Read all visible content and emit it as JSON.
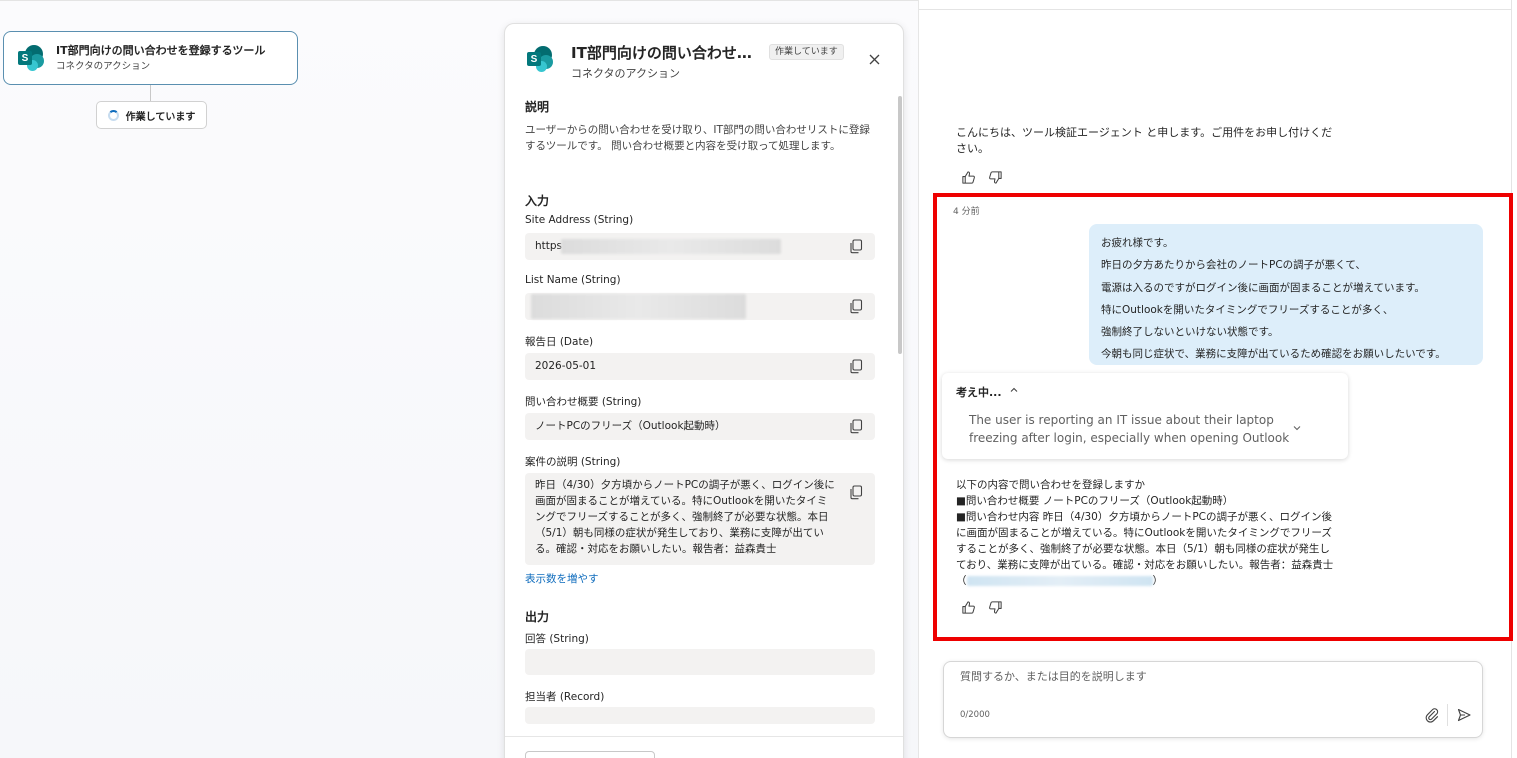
{
  "canvas": {
    "node": {
      "title": "IT部門向けの問い合わせを登録するツール",
      "subtitle": "コネクタのアクション"
    },
    "status": "作業しています"
  },
  "panel": {
    "title": "IT部門向けの問い合わせ…",
    "badge": "作業しています",
    "subtitle": "コネクタのアクション",
    "description_heading": "説明",
    "description": "ユーザーからの問い合わせを受け取り、IT部門の問い合わせリストに登録するツールです。 問い合わせ概要と内容を受け取って処理します。",
    "input_heading": "入力",
    "fields": {
      "site_address_label": "Site Address (String)",
      "site_address_value": "https:",
      "list_name_label": "List Name (String)",
      "report_date_label": "報告日 (Date)",
      "report_date_value": "2026-05-01",
      "summary_label": "問い合わせ概要 (String)",
      "summary_value": "ノートPCのフリーズ（Outlook起動時）",
      "case_desc_label": "案件の説明 (String)",
      "case_desc_value": "昨日（4/30）夕方頃からノートPCの調子が悪く、ログイン後に画面が固まることが増えている。特にOutlookを開いたタイミングでフリーズすることが多く、強制終了が必要な状態。本日（5/1）朝も同様の症状が発生しており、業務に支障が出ている。確認・対応をお願いしたい。報告者：益森貴士"
    },
    "show_more": "表示数を増やす",
    "output_heading": "出力",
    "outputs": {
      "answer_label": "回答 (String)",
      "assignee_label": "担当者 (Record)"
    }
  },
  "chat": {
    "greeting": "こんにちは、ツール検証エージェント と申します。ご用件をお申し付けください。",
    "timestamp": "4 分前",
    "user_lines": [
      "お疲れ様です。",
      "昨日の夕方あたりから会社のノートPCの調子が悪くて、",
      "電源は入るのですがログイン後に画面が固まることが増えています。",
      "特にOutlookを開いたタイミングでフリーズすることが多く、",
      "強制終了しないといけない状態です。",
      "今朝も同じ症状で、業務に支障が出ているため確認をお願いしたいです。"
    ],
    "thinking_heading": "考え中...",
    "thinking_text": "The user is reporting an IT issue about their laptop freezing after login, especially when opening Outlook",
    "reply_lines": [
      "以下の内容で問い合わせを登録しますか",
      "■問い合わせ概要 ノートPCのフリーズ（Outlook起動時）",
      "■問い合わせ内容 昨日（4/30）夕方頃からノートPCの調子が悪く、ログイン後に画面が固まることが増えている。特にOutlookを開いたタイミングでフリーズすることが多く、強制終了が必要な状態。本日（5/1）朝も同様の症状が発生しており、業務に支障が出ている。確認・対応をお願いしたい。報告者：益森貴士（",
      "）"
    ],
    "composer": {
      "placeholder": "質問するか、または目的を説明します",
      "counter": "0/2000"
    }
  },
  "colors": {
    "accent": "#0f6cbd",
    "highlight": "#ee0000",
    "user_bubble": "#ddeefa",
    "sharepoint": "#036c70"
  }
}
